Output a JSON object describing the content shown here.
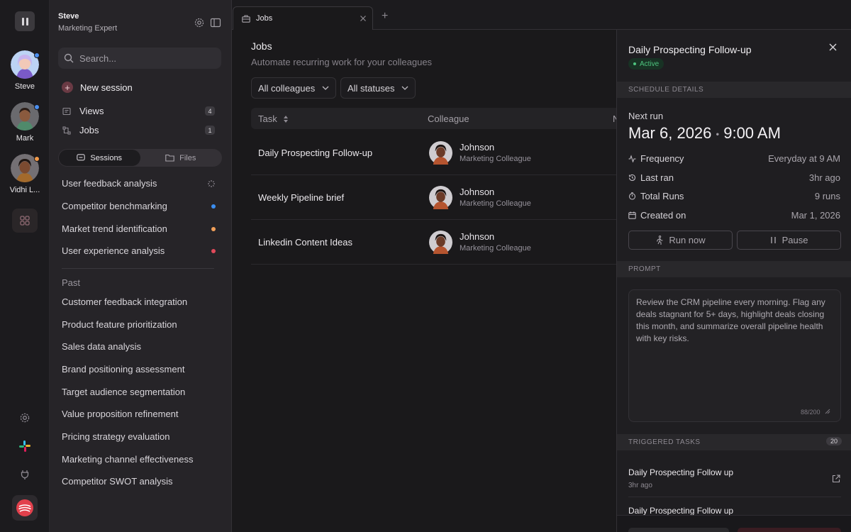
{
  "rail": {
    "colleagues": [
      {
        "name": "Steve",
        "status_color": "#4a8ff0"
      },
      {
        "name": "Mark",
        "status_color": "#4a8ff0"
      },
      {
        "name": "Vidhi L...",
        "status_color": "#f29a4a"
      }
    ],
    "icons": [
      "logo-icon",
      "group-icon",
      "settings-icon",
      "slack-icon",
      "plug-icon",
      "app-logo-icon"
    ]
  },
  "sidebar": {
    "user_name": "Steve",
    "user_role": "Marketing Expert",
    "search_placeholder": "Search...",
    "new_session": "New session",
    "nav": [
      {
        "label": "Views",
        "count": "4"
      },
      {
        "label": "Jobs",
        "count": "1"
      }
    ],
    "segment": {
      "sessions": "Sessions",
      "files": "Files"
    },
    "sessions": [
      {
        "title": "User feedback analysis",
        "status": "loading"
      },
      {
        "title": "Competitor benchmarking",
        "status_color": "#3b8ef0"
      },
      {
        "title": "Market trend identification",
        "status_color": "#f2a05a"
      },
      {
        "title": "User experience analysis",
        "status_color": "#e0495a"
      }
    ],
    "past_heading": "Past",
    "past": [
      "Customer feedback integration",
      "Product feature prioritization",
      "Sales data analysis",
      "Brand positioning assessment",
      "Target audience segmentation",
      "Value proposition refinement",
      "Pricing strategy evaluation",
      "Marketing channel effectiveness",
      "Competitor SWOT analysis"
    ]
  },
  "tabs": {
    "active": "Jobs",
    "add": "+"
  },
  "main": {
    "title": "Jobs",
    "subtitle": "Automate recurring work for your colleagues",
    "filters": {
      "colleagues": "All colleagues",
      "statuses": "All statuses"
    },
    "columns": {
      "task": "Task",
      "colleague": "Colleague",
      "next": "N"
    },
    "rows": [
      {
        "task": "Daily Prospecting Follow-up",
        "colleague": "Johnson",
        "role": "Marketing Colleague"
      },
      {
        "task": "Weekly Pipeline brief",
        "colleague": "Johnson",
        "role": "Marketing Colleague"
      },
      {
        "task": "Linkedin Content Ideas",
        "colleague": "Johnson",
        "role": "Marketing Colleague"
      }
    ]
  },
  "panel": {
    "title": "Daily Prospecting Follow-up",
    "status": "Active",
    "schedule_heading": "SCHEDULE DETAILS",
    "next_run_label": "Next run",
    "next_run_date": "Mar 6, 2026",
    "next_run_sep": "•",
    "next_run_time": "9:00 AM",
    "details": [
      {
        "icon": "pulse-icon",
        "label": "Frequency",
        "value": "Everyday at 9 AM"
      },
      {
        "icon": "history-icon",
        "label": "Last ran",
        "value": "3hr ago"
      },
      {
        "icon": "timer-icon",
        "label": "Total Runs",
        "value": "9 runs"
      },
      {
        "icon": "calendar-icon",
        "label": "Created on",
        "value": "Mar 1, 2026"
      }
    ],
    "run_now": "Run now",
    "pause": "Pause",
    "prompt_heading": "PROMPT",
    "prompt_text": "Review the CRM pipeline every morning. Flag any deals stagnant for 5+ days, highlight deals closing this month, and summarize overall pipeline health with key risks.",
    "prompt_count": "88/200",
    "triggered_heading": "TRIGGERED TASKS",
    "triggered_count": "20",
    "triggered": [
      {
        "title": "Daily Prospecting Follow up",
        "ago": "3hr ago"
      },
      {
        "title": "Daily Prospecting Follow up",
        "ago": ""
      }
    ]
  }
}
